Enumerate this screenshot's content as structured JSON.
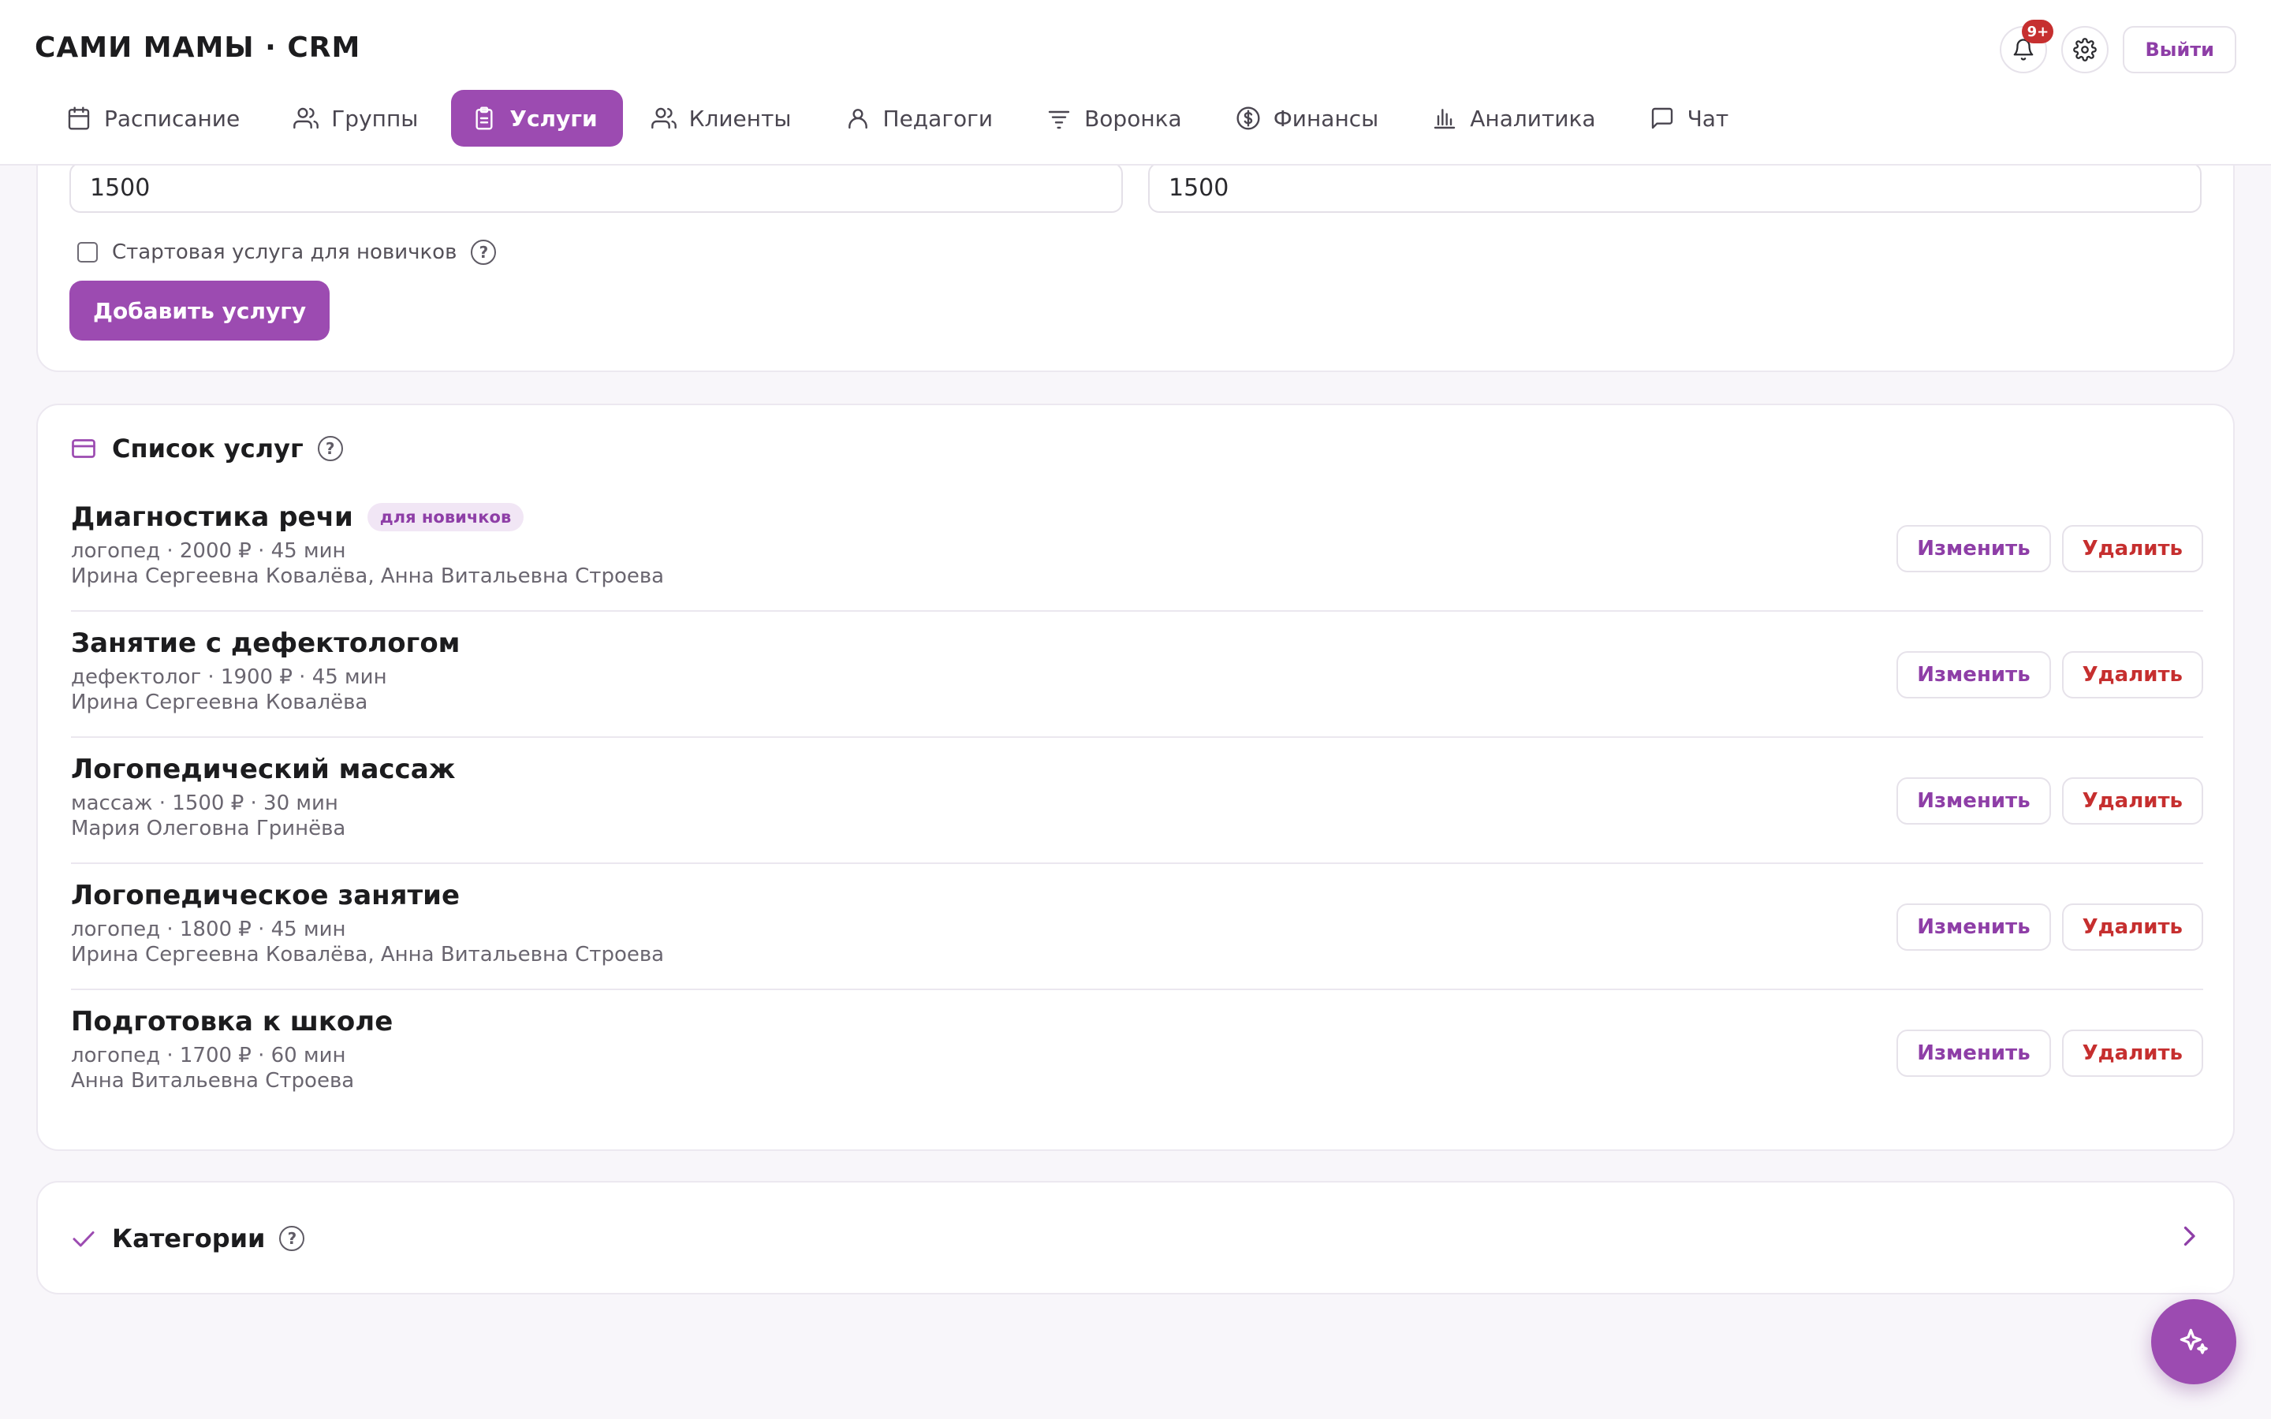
{
  "app": {
    "title": "САМИ МАМЫ · CRM"
  },
  "header": {
    "notifications_badge": "9+",
    "logout_label": "Выйти"
  },
  "nav": {
    "items": [
      {
        "label": "Расписание",
        "icon": "calendar-icon"
      },
      {
        "label": "Группы",
        "icon": "users-icon"
      },
      {
        "label": "Услуги",
        "icon": "clipboard-icon",
        "active": true
      },
      {
        "label": "Клиенты",
        "icon": "users-icon"
      },
      {
        "label": "Педагоги",
        "icon": "user-icon"
      },
      {
        "label": "Воронка",
        "icon": "filter-icon"
      },
      {
        "label": "Финансы",
        "icon": "dollar-icon"
      },
      {
        "label": "Аналитика",
        "icon": "bar-chart-icon"
      },
      {
        "label": "Чат",
        "icon": "chat-icon"
      }
    ]
  },
  "form": {
    "price_value": "1500",
    "price_second_value": "1500",
    "starter_checkbox_label": "Стартовая услуга для новичков",
    "starter_checked": false,
    "submit_label": "Добавить услугу"
  },
  "services": {
    "title": "Список услуг",
    "edit_label": "Изменить",
    "delete_label": "Удалить",
    "items": [
      {
        "title": "Диагностика речи",
        "badge": "для новичков",
        "meta": "логопед · 2000 ₽ · 45 мин",
        "teachers": "Ирина Сергеевна Ковалёва, Анна Витальевна Строева"
      },
      {
        "title": "Занятие с дефектологом",
        "badge": "",
        "meta": "дефектолог · 1900 ₽ · 45 мин",
        "teachers": "Ирина Сергеевна Ковалёва"
      },
      {
        "title": "Логопедический массаж",
        "badge": "",
        "meta": "массаж · 1500 ₽ · 30 мин",
        "teachers": "Мария Олеговна Гринёва"
      },
      {
        "title": "Логопедическое занятие",
        "badge": "",
        "meta": "логопед · 1800 ₽ · 45 мин",
        "teachers": "Ирина Сергеевна Ковалёва, Анна Витальевна Строева"
      },
      {
        "title": "Подготовка к школе",
        "badge": "",
        "meta": "логопед · 1700 ₽ · 60 мин",
        "teachers": "Анна Витальевна Строева"
      }
    ]
  },
  "categories": {
    "title": "Категории"
  },
  "colors": {
    "accent": "#9c4bb1",
    "danger": "#c62f2f",
    "badge_bg": "#f1e6f5"
  }
}
